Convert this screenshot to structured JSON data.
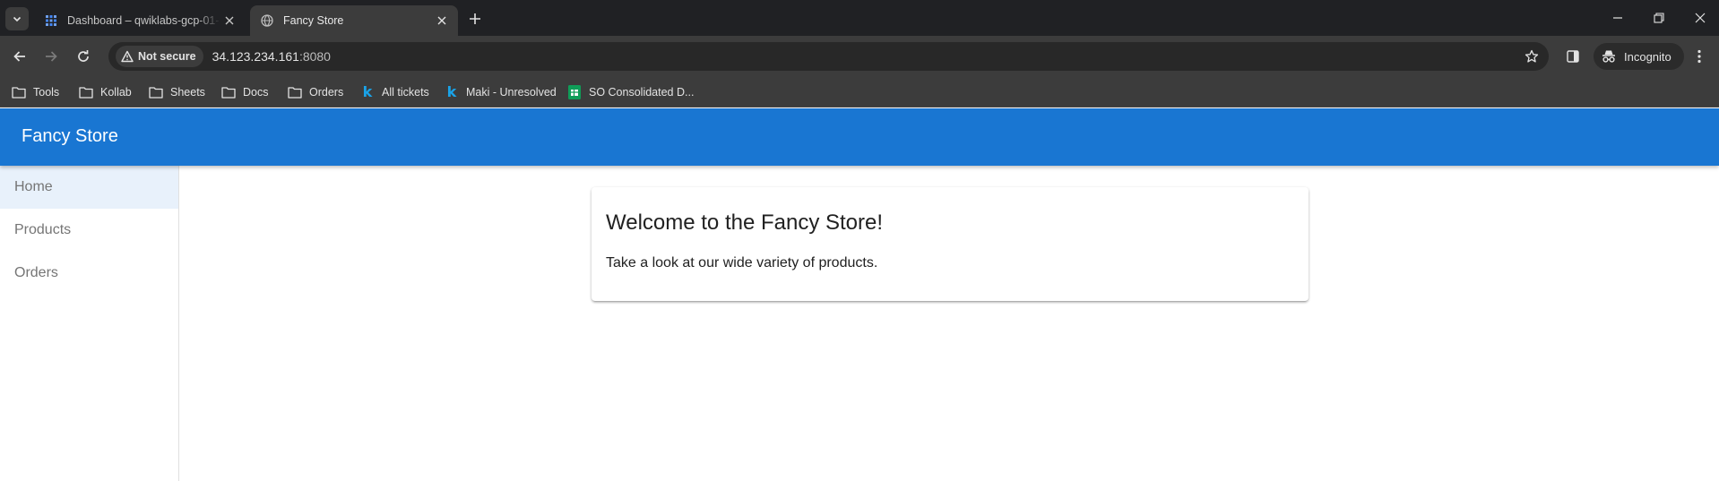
{
  "browser": {
    "tabs": [
      {
        "title": "Dashboard – qwiklabs-gcp-01-",
        "active": false
      },
      {
        "title": "Fancy Store",
        "active": true
      }
    ],
    "omnibox": {
      "security_label": "Not secure",
      "host": "34.123.234.161",
      "port": ":8080"
    },
    "profile_label": "Incognito",
    "bookmarks": [
      {
        "label": "Tools",
        "icon": "folder-icon"
      },
      {
        "label": "Kollab",
        "icon": "folder-icon"
      },
      {
        "label": "Sheets",
        "icon": "folder-icon"
      },
      {
        "label": "Docs",
        "icon": "folder-icon"
      },
      {
        "label": "Orders",
        "icon": "folder-icon"
      },
      {
        "label": "All tickets",
        "icon": "k-icon"
      },
      {
        "label": "Maki - Unresolved",
        "icon": "k-icon"
      },
      {
        "label": "SO Consolidated D...",
        "icon": "sheets-icon"
      }
    ]
  },
  "app": {
    "title": "Fancy Store",
    "nav": [
      {
        "label": "Home",
        "active": true
      },
      {
        "label": "Products",
        "active": false
      },
      {
        "label": "Orders",
        "active": false
      }
    ],
    "welcome_card": {
      "heading": "Welcome to the Fancy Store!",
      "body": "Take a look at our wide variety of products."
    }
  },
  "colors": {
    "app_bar": "#1976d2",
    "active_nav_bg": "#e8f1fb",
    "browser_frame": "#202124",
    "toolbar": "#3c3c3c"
  }
}
